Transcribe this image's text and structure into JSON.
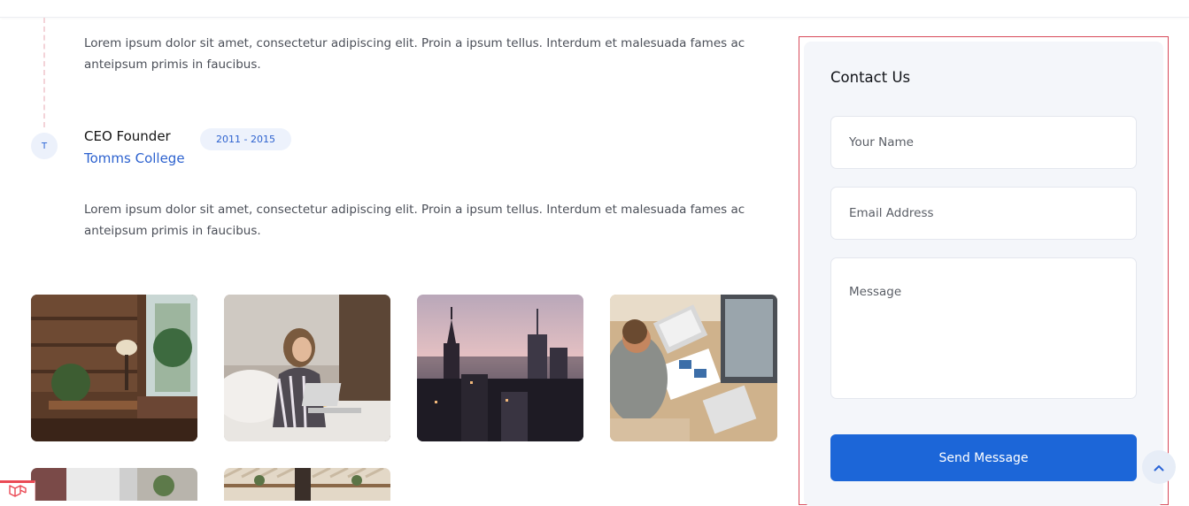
{
  "timeline": {
    "intro_text": "Lorem ipsum dolor sit amet, consectetur adipiscing elit. Proin a ipsum tellus. Interdum et malesuada fames ac anteipsum primis in faucibus.",
    "entry": {
      "marker": "T",
      "title": "CEO Founder",
      "years": "2011 - 2015",
      "organization": "Tomms College",
      "description": "Lorem ipsum dolor sit amet, consectetur adipiscing elit. Proin a ipsum tellus. Interdum et malesuada fames ac anteipsum primis in faucibus."
    }
  },
  "gallery": {
    "items": [
      {
        "name": "living-room-photo"
      },
      {
        "name": "woman-with-laptop-photo"
      },
      {
        "name": "city-skyline-photo"
      },
      {
        "name": "desk-laptops-photo"
      },
      {
        "name": "gallery-photo-5"
      },
      {
        "name": "gallery-photo-6"
      }
    ]
  },
  "contact": {
    "title": "Contact Us",
    "name_placeholder": "Your Name",
    "email_placeholder": "Email Address",
    "message_placeholder": "Message",
    "submit_label": "Send Message"
  },
  "icons": {
    "scroll_top": "chevron-up-icon",
    "corner_widget": "laravel-logo-icon"
  },
  "colors": {
    "accent": "#1c66d8",
    "link": "#2d62cf",
    "card_background": "#f4f6fa",
    "outline": "#d84a5a"
  }
}
